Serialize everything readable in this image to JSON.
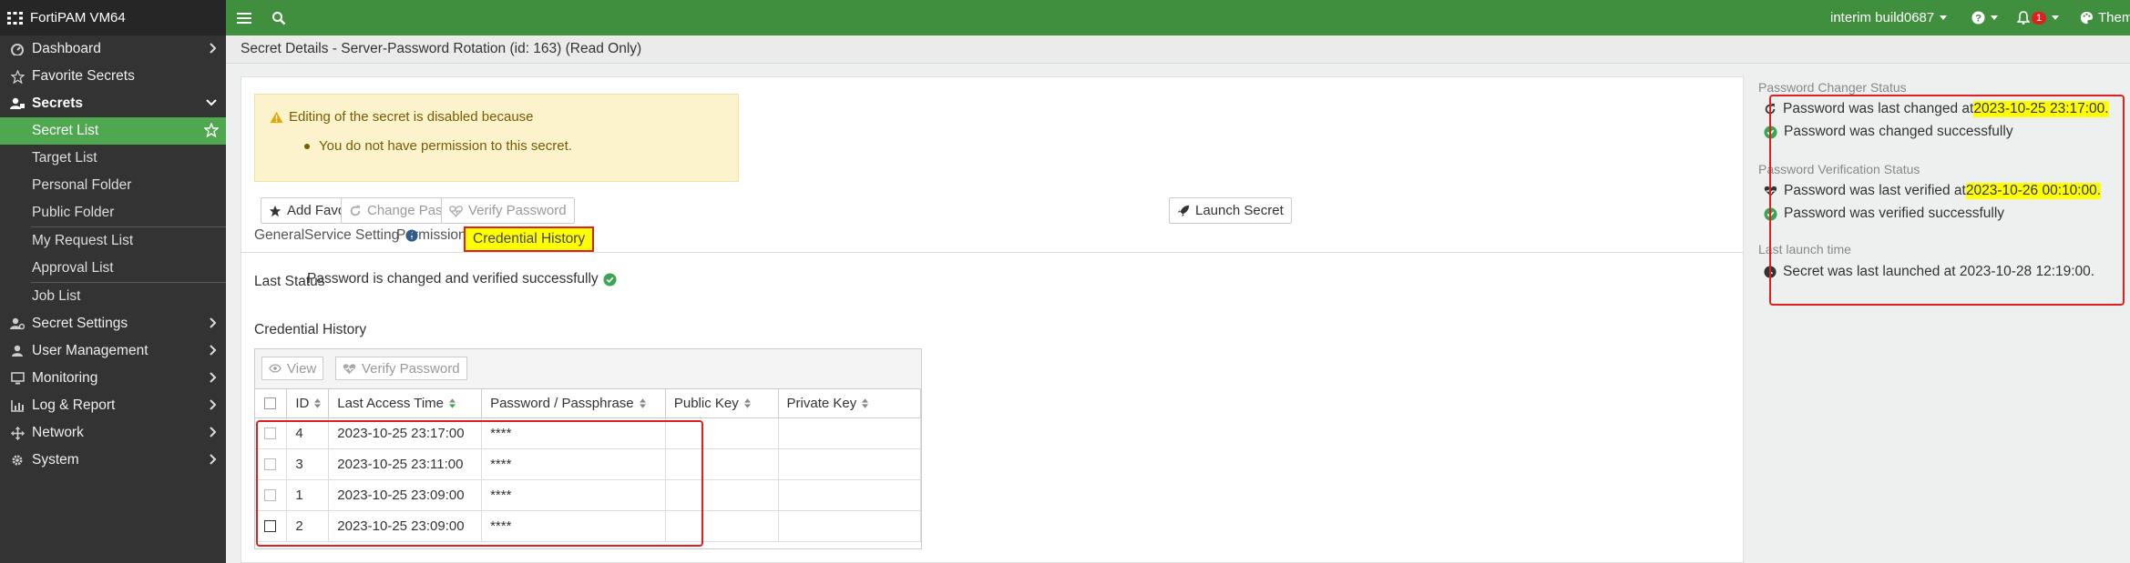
{
  "app": {
    "title": "FortiPAM VM64"
  },
  "sidebar": {
    "items": [
      {
        "label": "Dashboard",
        "icon": "dashboard-icon"
      },
      {
        "label": "Favorite Secrets",
        "icon": "star-icon"
      },
      {
        "label": "Secrets",
        "icon": "secrets-icon"
      },
      {
        "label": "Secret List"
      },
      {
        "label": "Target List"
      },
      {
        "label": "Personal Folder"
      },
      {
        "label": "Public Folder"
      },
      {
        "label": "My Request List"
      },
      {
        "label": "Approval List"
      },
      {
        "label": "Job List"
      },
      {
        "label": "Secret Settings",
        "icon": "user-gear-icon"
      },
      {
        "label": "User Management",
        "icon": "user-icon"
      },
      {
        "label": "Monitoring",
        "icon": "monitor-icon"
      },
      {
        "label": "Log & Report",
        "icon": "chart-icon"
      },
      {
        "label": "Network",
        "icon": "network-icon"
      },
      {
        "label": "System",
        "icon": "gear-icon"
      }
    ]
  },
  "topbar": {
    "build": "interim build0687",
    "alerts_count": "1",
    "theme_label": "Them"
  },
  "breadcrumb": "Secret Details - Server-Password Rotation (id: 163) (Read Only)",
  "warning": {
    "title": "Editing of the secret is disabled because",
    "reason": "You do not have permission to this secret."
  },
  "actions": {
    "add_favorite": "Add Favorite",
    "change_password": "Change Password",
    "verify_password": "Verify Password",
    "launch_secret": "Launch Secret"
  },
  "tabs": {
    "general": "General",
    "service_setting": "Service Setting",
    "permission": "Permission",
    "credential_history": "Credential History"
  },
  "last_status": {
    "label": "Last Status",
    "value": "Password is changed and verified successfully"
  },
  "credential_history": {
    "title": "Credential History",
    "view_label": "View",
    "verify_label": "Verify Password",
    "columns": {
      "id": "ID",
      "last_access": "Last Access Time",
      "password": "Password / Passphrase",
      "public_key": "Public Key",
      "private_key": "Private Key"
    },
    "rows": [
      {
        "id": "4",
        "time": "2023-10-25 23:17:00",
        "password": "****"
      },
      {
        "id": "3",
        "time": "2023-10-25 23:11:00",
        "password": "****"
      },
      {
        "id": "1",
        "time": "2023-10-25 23:09:00",
        "password": "****"
      },
      {
        "id": "2",
        "time": "2023-10-25 23:09:00",
        "password": "****"
      }
    ]
  },
  "status_panel": {
    "changer_title": "Password Changer Status",
    "changed_prefix": "Password was last changed at ",
    "changed_at": "2023-10-25 23:17:00.",
    "changed_ok": "Password was changed successfully",
    "verify_title": "Password Verification Status",
    "verified_prefix": "Password was last verified at ",
    "verified_at": "2023-10-26 00:10:00.",
    "verified_ok": "Password was verified successfully",
    "launch_title": "Last launch time",
    "launched": "Secret was last launched at 2023-10-28 12:19:00."
  },
  "colors": {
    "brand_green": "#3f8f3f",
    "active_green": "#4fa84f",
    "highlight": "#ffff00",
    "annotation_red": "#e02020",
    "success": "#3aa655"
  }
}
